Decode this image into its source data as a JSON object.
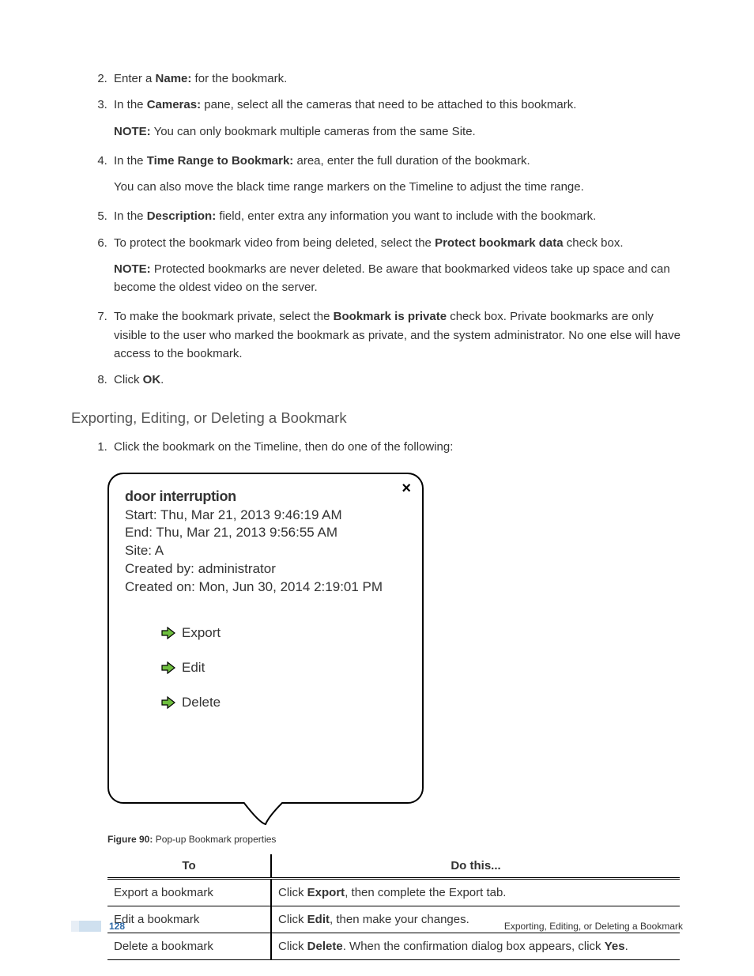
{
  "steps_main": [
    {
      "n": 2,
      "prefix": "Enter a ",
      "bold": "Name:",
      "suffix": " for the bookmark."
    },
    {
      "n": 3,
      "prefix": "In the ",
      "bold": "Cameras:",
      "suffix": " pane, select all the cameras that need to be attached to this bookmark.",
      "note_label": "NOTE:",
      "note": " You can only bookmark multiple cameras from the same Site."
    },
    {
      "n": 4,
      "prefix": "In the ",
      "bold": "Time Range to Bookmark:",
      "suffix": " area, enter the full duration of the bookmark.",
      "extra": "You can also move the black time range markers on the Timeline to adjust the time range."
    },
    {
      "n": 5,
      "prefix": "In the ",
      "bold": "Description:",
      "suffix": " field, enter extra any information you want to include with the bookmark."
    },
    {
      "n": 6,
      "prefix": "To protect the bookmark video from being deleted, select the ",
      "bold": "Protect bookmark data",
      "suffix": " check box.",
      "note_label": "NOTE:",
      "note": " Protected bookmarks are never deleted. Be aware that bookmarked videos take up space and can become the oldest video on the server."
    },
    {
      "n": 7,
      "prefix": "To make the bookmark private, select the ",
      "bold": "Bookmark is private",
      "suffix": " check box. Private bookmarks are only visible to the user who marked the bookmark as private, and the system administrator. No one else will have access to the bookmark."
    },
    {
      "n": 8,
      "prefix": "Click ",
      "bold": "OK",
      "suffix": "."
    }
  ],
  "section_heading": "Exporting, Editing, or Deleting a Bookmark",
  "sub_step": "Click the bookmark on the Timeline, then do one of the following:",
  "popup": {
    "title": "door interruption",
    "start": "Start: Thu, Mar 21, 2013 9:46:19 AM",
    "end": "End: Thu, Mar 21, 2013 9:56:55 AM",
    "site": "Site: A",
    "created_by": "Created by: administrator",
    "created_on": "Created on: Mon, Jun 30, 2014 2:19:01 PM",
    "actions": {
      "export": "Export",
      "edit": "Edit",
      "delete": "Delete"
    },
    "close": "×"
  },
  "figure": {
    "label": "Figure 90:",
    "caption": " Pop-up Bookmark properties"
  },
  "table": {
    "headers": {
      "to": "To",
      "do": "Do this..."
    },
    "rows": [
      {
        "to": "Export a bookmark",
        "pre": "Click ",
        "b1": "Export",
        "post": ", then complete the Export tab."
      },
      {
        "to": "Edit a bookmark",
        "pre": "Click ",
        "b1": "Edit",
        "post": ", then make your changes."
      },
      {
        "to": "Delete a bookmark",
        "pre": "Click ",
        "b1": "Delete",
        "mid": ". When the confirmation dialog box appears, click ",
        "b2": "Yes",
        "post": "."
      }
    ]
  },
  "footer": {
    "page": "128",
    "topic": "Exporting, Editing, or Deleting a Bookmark"
  }
}
